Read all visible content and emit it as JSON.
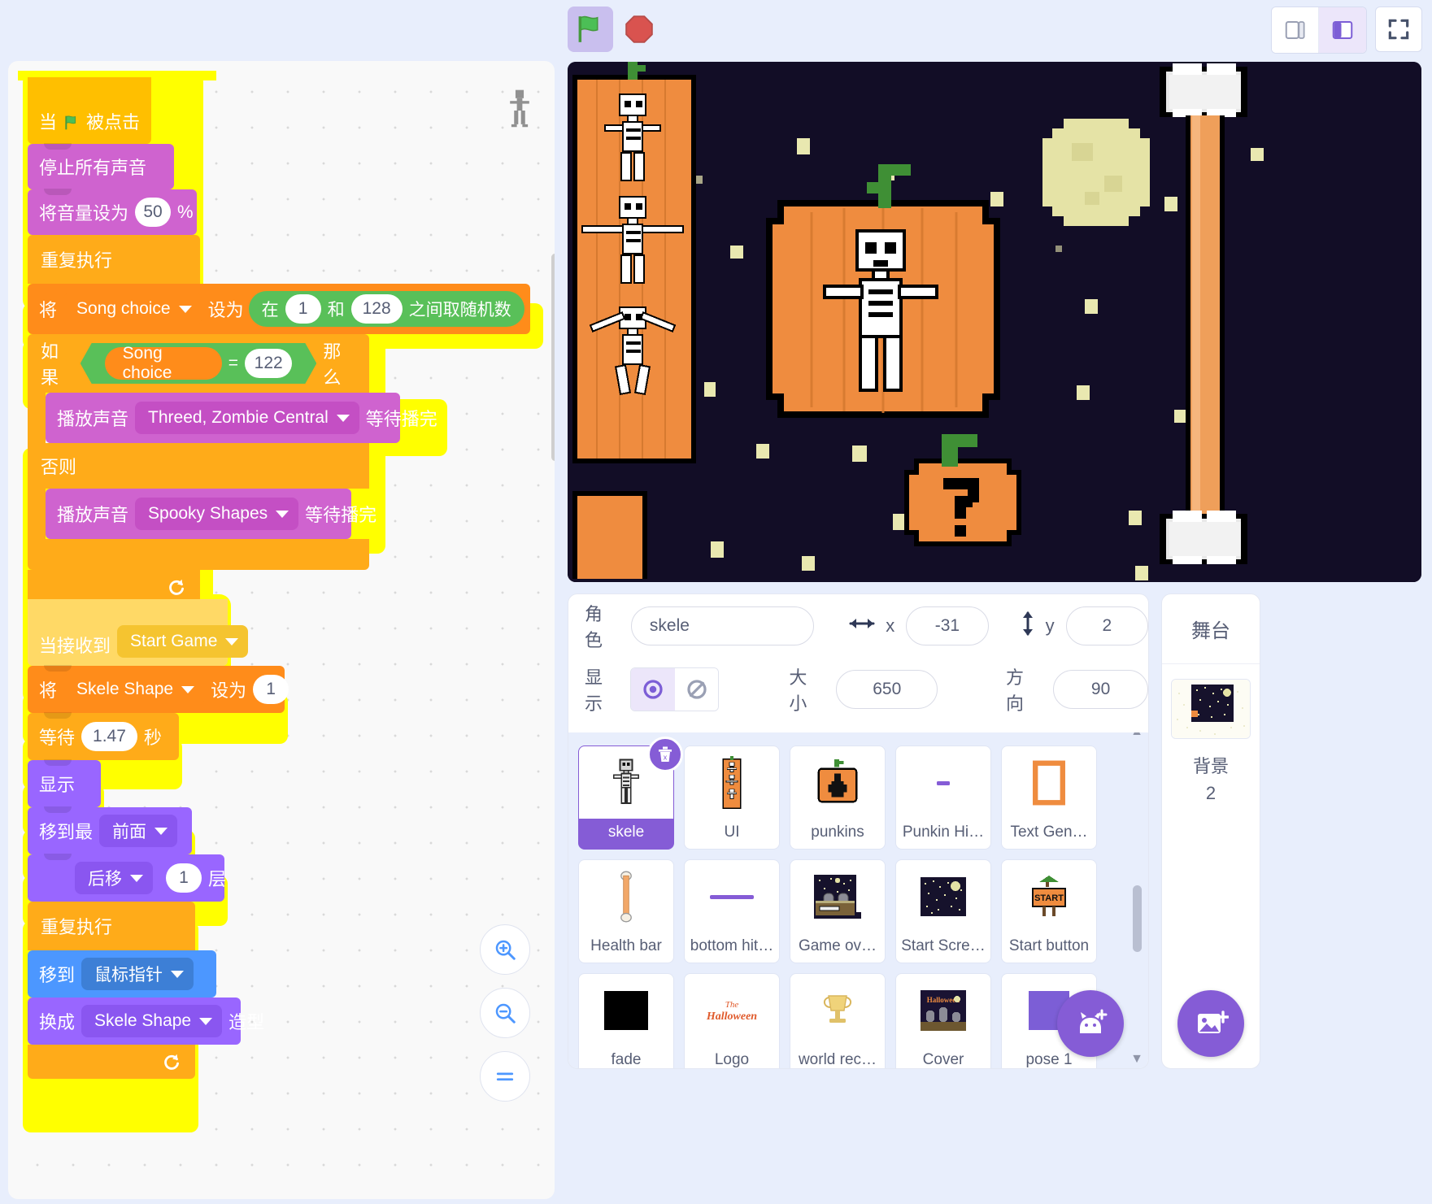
{
  "toolbar": {
    "green_flag": "green-flag",
    "stop": "stop-sign",
    "layout_small": "small-stage-layout",
    "layout_large": "large-stage-layout",
    "fullscreen": "fullscreen"
  },
  "scripts": [
    {
      "id": "script-flag",
      "hat": {
        "prefix": "当",
        "suffix": "被点击",
        "icon": "green-flag"
      },
      "blocks": [
        {
          "type": "sound",
          "label": "停止所有声音"
        },
        {
          "type": "sound",
          "label_a": "将音量设为",
          "value": "50",
          "label_b": "%"
        },
        {
          "type": "control",
          "label": "重复执行"
        }
      ],
      "set_var": {
        "label_a": "将",
        "variable": "Song choice",
        "label_b": "设为"
      },
      "random": {
        "label_a": "在",
        "min": "1",
        "label_b": "和",
        "max": "128",
        "label_c": "之间取随机数"
      },
      "if_else": {
        "if_label": "如果",
        "then_label": "那么",
        "else_label": "否则",
        "cond_var": "Song choice",
        "cond_op": "=",
        "cond_val": "122",
        "then_block": {
          "label_a": "播放声音",
          "sound": "Threed, Zombie Central",
          "label_b": "等待播完"
        },
        "else_block": {
          "label_a": "播放声音",
          "sound": "Spooky Shapes",
          "label_b": "等待播完"
        }
      }
    },
    {
      "id": "script-message",
      "hat": {
        "prefix": "当接收到",
        "message": "Start Game"
      },
      "blocks": [
        {
          "type": "var",
          "label_a": "将",
          "variable": "Skele Shape",
          "label_b": "设为",
          "value": "1"
        },
        {
          "type": "control",
          "label_a": "等待",
          "value": "1.47",
          "label_b": "秒"
        },
        {
          "type": "look",
          "label": "显示"
        },
        {
          "type": "look",
          "label_a": "移到最",
          "option": "前面"
        },
        {
          "type": "look",
          "option": "后移",
          "value": "1",
          "label_b": "层"
        },
        {
          "type": "control",
          "label": "重复执行"
        },
        {
          "type": "motion",
          "label_a": "移到",
          "option": "鼠标指针"
        },
        {
          "type": "look",
          "label_a": "换成",
          "option": "Skele Shape",
          "label_b": "造型"
        }
      ]
    }
  ],
  "zoom_controls": {
    "zoom_in": "zoom-in",
    "zoom_out": "zoom-out",
    "zoom_reset": "zoom-reset"
  },
  "sprite_info": {
    "name_label": "角色",
    "name_value": "skele",
    "x_label": "x",
    "x_value": "-31",
    "y_label": "y",
    "y_value": "2",
    "show_label": "显示",
    "size_label": "大小",
    "size_value": "650",
    "direction_label": "方向",
    "direction_value": "90",
    "visible_on": true
  },
  "sprites": [
    {
      "name": "skele",
      "icon": "skeleton",
      "selected": true
    },
    {
      "name": "UI",
      "icon": "ui-banner",
      "selected": false
    },
    {
      "name": "punkins",
      "icon": "pumpkin",
      "selected": false
    },
    {
      "name": "Punkin Hi…",
      "icon": "small-dash",
      "selected": false
    },
    {
      "name": "Text Gen…",
      "icon": "letter-o",
      "selected": false
    },
    {
      "name": "Health bar",
      "icon": "bone-bar",
      "selected": false
    },
    {
      "name": "bottom hit…",
      "icon": "purple-line",
      "selected": false
    },
    {
      "name": "Game ov…",
      "icon": "graveyard",
      "selected": false
    },
    {
      "name": "Start Scre…",
      "icon": "night-sky",
      "selected": false
    },
    {
      "name": "Start button",
      "icon": "start-sign",
      "selected": false
    },
    {
      "name": "fade",
      "icon": "black-square",
      "selected": false
    },
    {
      "name": "Logo",
      "icon": "halloween-logo",
      "selected": false
    },
    {
      "name": "world rec…",
      "icon": "trophy",
      "selected": false
    },
    {
      "name": "Cover",
      "icon": "cover-art",
      "selected": false
    },
    {
      "name": "pose 1",
      "icon": "purple-square",
      "selected": false
    }
  ],
  "stage_panel": {
    "title": "舞台",
    "label": "背景",
    "count": "2"
  },
  "fabs": {
    "add_sprite": "add-sprite",
    "add_backdrop": "add-backdrop"
  },
  "colors": {
    "events": "#ffbf00",
    "events_light": "#ffd966",
    "sound": "#cf63cf",
    "control": "#ffab19",
    "variables": "#ff8c1a",
    "looks": "#9966ff",
    "motion": "#4c97ff",
    "operators": "#59c059",
    "accent": "#855cd6",
    "glow": "#ffff00"
  }
}
